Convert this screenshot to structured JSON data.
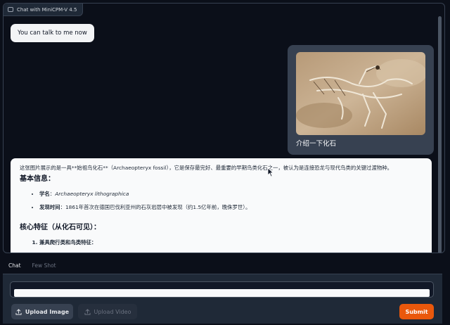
{
  "chat": {
    "label": "Chat with MiniCPM-V 4.5",
    "messages": {
      "greeting": "You can talk to me now",
      "user_text": "介绍一下化石",
      "bot_intro": "这张图片展示的是一具**始祖鸟化石**（Archaeopteryx fossil），它是保存最完好、最重要的早期鸟类化石之一，被认为是连接恐龙与现代鸟类的关键过渡物种。",
      "bot_h3_basic": "基本信息：",
      "bot_item1_key": "学名",
      "bot_item1_sep": "：",
      "bot_item1_val": "Archaeopteryx lithographica",
      "bot_item2_key": "发现时间",
      "bot_item2_sep": "：",
      "bot_item2_val": "1861年首次在德国巴伐利亚州的石灰岩层中被发现（约1.5亿年前，晚侏罗世）。",
      "bot_h3_core": "核心特征（从化石可见）：",
      "bot_olist1": "兼具爬行类和鸟类特征："
    }
  },
  "tabs": [
    {
      "label": "Chat"
    },
    {
      "label": "Few Shot"
    }
  ],
  "input": {
    "placeholder": ""
  },
  "buttons": {
    "upload_image": "Upload Image",
    "upload_video": "Upload Video",
    "submit": "Submit"
  },
  "colors": {
    "accent": "#ea580c",
    "background": "#0b0f19",
    "panel": "#1f2937"
  }
}
